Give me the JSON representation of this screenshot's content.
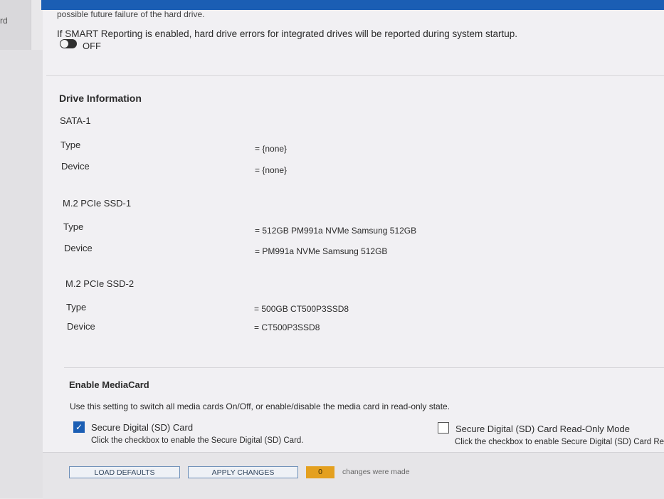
{
  "sidebar": {
    "cut_label": "rd"
  },
  "smart": {
    "cut_text": "possible future failure of the hard drive.",
    "description": "If SMART Reporting is enabled, hard drive errors for integrated drives will be reported during system startup.",
    "toggle_state": "OFF"
  },
  "drive_info": {
    "title": "Drive Information",
    "groups": [
      {
        "name": "SATA-1",
        "rows": [
          {
            "label": "Type",
            "value": "= {none}"
          },
          {
            "label": "Device",
            "value": "= {none}"
          }
        ]
      },
      {
        "name": "M.2 PCIe SSD-1",
        "rows": [
          {
            "label": "Type",
            "value": "= 512GB PM991a NVMe Samsung 512GB"
          },
          {
            "label": "Device",
            "value": "= PM991a NVMe Samsung 512GB"
          }
        ]
      },
      {
        "name": "M.2 PCIe SSD-2",
        "rows": [
          {
            "label": "Type",
            "value": "= 500GB CT500P3SSD8"
          },
          {
            "label": "Device",
            "value": "= CT500P3SSD8"
          }
        ]
      }
    ]
  },
  "mediacard": {
    "title": "Enable MediaCard",
    "description": "Use this setting to switch all media cards On/Off, or enable/disable the media card in read-only state.",
    "options": [
      {
        "label": "Secure Digital (SD) Card",
        "hint": "Click the checkbox to enable the Secure Digital (SD) Card.",
        "checked": true
      },
      {
        "label": "Secure Digital (SD) Card Read-Only Mode",
        "hint": "Click the checkbox to enable Secure Digital (SD) Card Re",
        "checked": false
      }
    ]
  },
  "footer": {
    "load_defaults": "LOAD DEFAULTS",
    "apply_changes": "APPLY CHANGES",
    "changes_count": "0",
    "changes_text": "changes were made"
  },
  "colors": {
    "accent": "#1b5eb4",
    "counter": "#e4a01f",
    "background": "#f1f0f3"
  }
}
